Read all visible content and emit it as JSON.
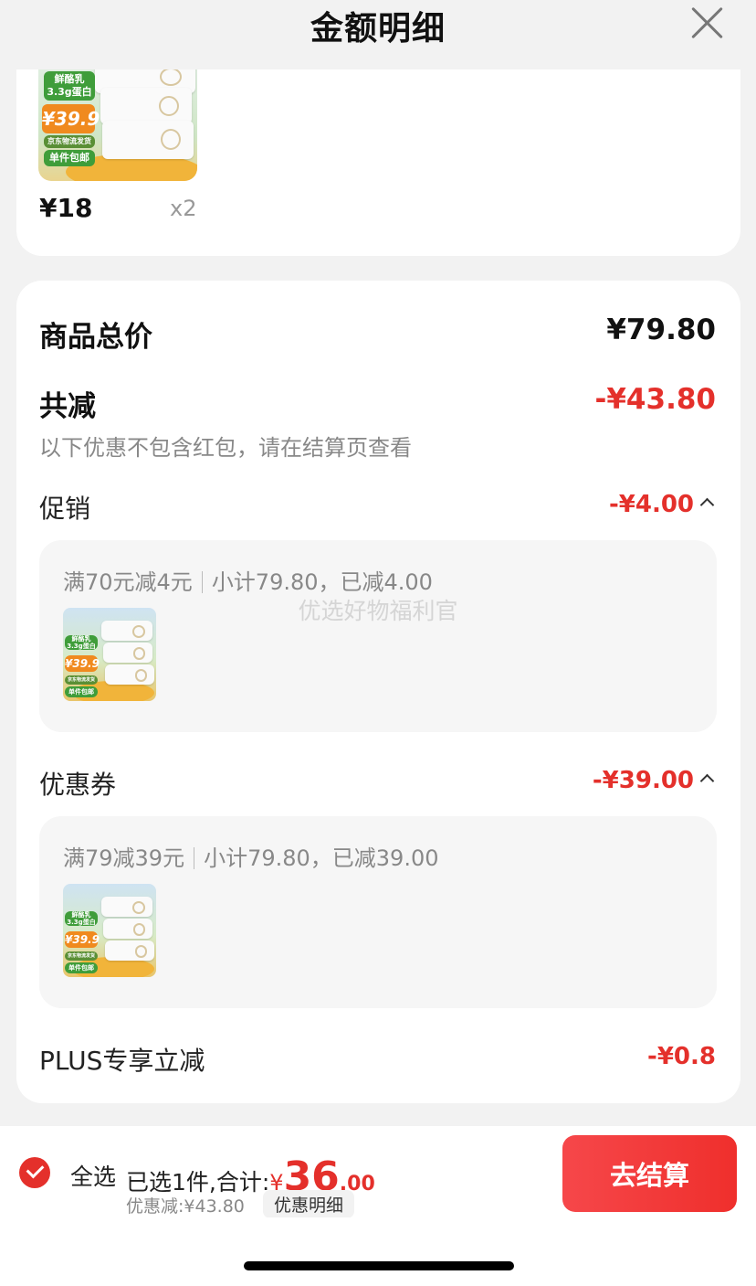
{
  "header": {
    "title": "金额明细"
  },
  "product": {
    "price": "¥18",
    "qty": "x2",
    "image_texts": {
      "badge_line1": "鲜酪乳",
      "badge_line2": "3.3g蛋白",
      "price_tag": "¥39.9",
      "shipping": "京东物流发货",
      "free_ship": "单件包邮"
    }
  },
  "summary": {
    "goods_total_label": "商品总价",
    "goods_total_value": "¥79.80",
    "reduction_label": "共减",
    "reduction_value": "-¥43.80",
    "note": "以下优惠不包含红包，请在结算页查看"
  },
  "promotion": {
    "label": "促销",
    "value": "-¥4.00",
    "detail_rule": "满70元减4元",
    "detail_subtotal": "小计79.80，已减4.00",
    "watermark": "优选好物福利官"
  },
  "coupon": {
    "label": "优惠券",
    "value": "-¥39.00",
    "detail_rule": "满79减39元",
    "detail_subtotal": "小计79.80，已减39.00"
  },
  "plus": {
    "label": "PLUS专享立减",
    "value": "-¥0.8"
  },
  "bottom_bar": {
    "select_all": "全选",
    "selected_text": "已选1件,合计:",
    "currency": "¥",
    "total_int": "36",
    "total_dec": ".00",
    "discount_text": "优惠减:¥43.80",
    "detail_link": "优惠明细",
    "checkout": "去结算"
  },
  "colors": {
    "accent_red": "#e4302b",
    "background": "#f2f2f2"
  },
  "icons": [
    "close-icon",
    "chevron-up-icon",
    "checkmark-icon"
  ]
}
